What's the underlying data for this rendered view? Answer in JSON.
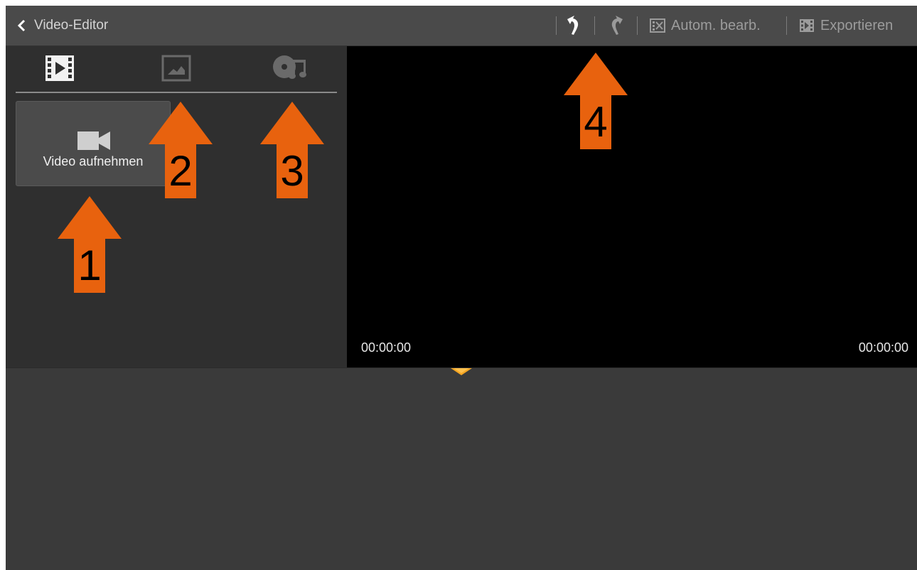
{
  "actionbar": {
    "back_icon": "chevron-left-icon",
    "title": "Video-Editor",
    "undo_icon": "undo-icon",
    "redo_icon": "redo-icon",
    "auto_edit_icon": "auto-edit-icon",
    "auto_edit_label": "Autom. bearb.",
    "export_icon": "export-film-icon",
    "export_label": "Exportieren"
  },
  "media_tabs": [
    {
      "icon": "film-strip-icon",
      "selected": true
    },
    {
      "icon": "image-icon",
      "selected": false
    },
    {
      "icon": "music-disc-icon",
      "selected": false
    }
  ],
  "record_button": {
    "icon": "video-camera-icon",
    "label": "Video aufnehmen"
  },
  "preview": {
    "time_current": "00:00:00",
    "time_total": "00:00:00"
  },
  "timeline": {
    "playhead_icon": "playhead-marker-icon"
  },
  "annotations": {
    "arrow_color": "#e8620e",
    "items": [
      {
        "number": "1",
        "icon": "up-arrow-icon"
      },
      {
        "number": "2",
        "icon": "up-arrow-icon"
      },
      {
        "number": "3",
        "icon": "up-arrow-icon"
      },
      {
        "number": "4",
        "icon": "up-arrow-icon"
      }
    ]
  },
  "colors": {
    "actionbar_bg": "#4a4a4a",
    "panel_bg": "#2f2f2f",
    "preview_bg": "#000000",
    "timeline_bg": "#3a3a3a",
    "playhead": "#f5a623"
  }
}
